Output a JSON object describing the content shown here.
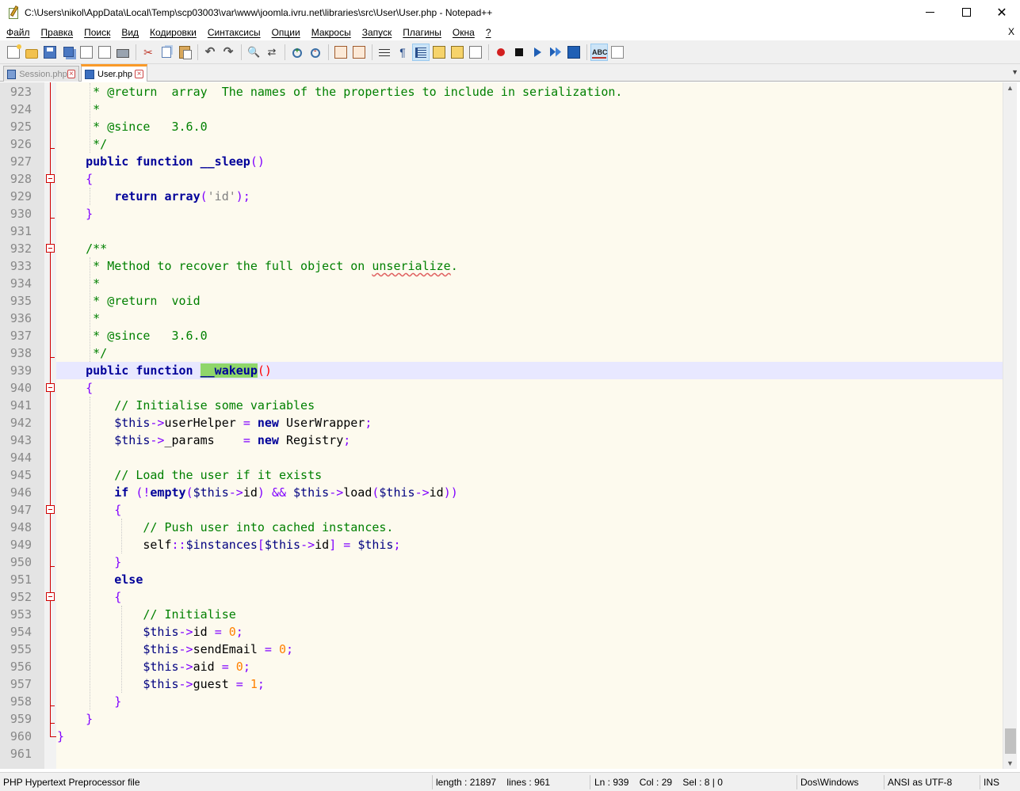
{
  "window": {
    "title": "C:\\Users\\nikol\\AppData\\Local\\Temp\\scp03003\\var\\www\\joomla.ivru.net\\libraries\\src\\User\\User.php - Notepad++",
    "min_glyph": "",
    "max_glyph": "",
    "close_glyph": "✕"
  },
  "menu": {
    "items": [
      "Файл",
      "Правка",
      "Поиск",
      "Вид",
      "Кодировки",
      "Синтаксисы",
      "Опции",
      "Макросы",
      "Запуск",
      "Плагины",
      "Окна",
      "?"
    ],
    "close_doc": "X"
  },
  "toolbar": {
    "icons": [
      "new-file-icon",
      "open-file-icon",
      "save-icon",
      "save-all-icon",
      "close-icon",
      "close-all-icon",
      "print-icon",
      "cut-icon",
      "copy-icon",
      "paste-icon",
      "undo-icon",
      "redo-icon",
      "find-icon",
      "replace-icon",
      "zoom-in-icon",
      "zoom-out-icon",
      "sync-vertical-icon",
      "sync-horizontal-icon",
      "word-wrap-icon",
      "show-all-chars-icon",
      "indent-guide-icon",
      "user-language-icon",
      "doc-map-icon",
      "function-list-icon",
      "record-macro-icon",
      "stop-macro-icon",
      "play-macro-icon",
      "run-macro-multiple-icon",
      "save-macro-icon",
      "spell-check-icon",
      "spell-options-icon"
    ]
  },
  "tabs": [
    {
      "label": "Session.php",
      "active": false
    },
    {
      "label": "User.php",
      "active": true
    }
  ],
  "editor": {
    "current_line": 939,
    "lines": [
      {
        "n": "923",
        "html": "     <span class=\"cm\">* @return  array  The names of the properties to include in serialization.</span>"
      },
      {
        "n": "924",
        "html": "     <span class=\"cm\">*</span>"
      },
      {
        "n": "925",
        "html": "     <span class=\"cm\">* @since   3.6.0</span>"
      },
      {
        "n": "926",
        "html": "     <span class=\"cm\">*/</span>"
      },
      {
        "n": "927",
        "html": "    <span class=\"k\">public</span> <span class=\"k\">function</span> <span class=\"fn\">__sleep</span><span class=\"br\">()</span>"
      },
      {
        "n": "928",
        "html": "    <span class=\"br\">{</span>"
      },
      {
        "n": "929",
        "html": "        <span class=\"k\">return</span> <span class=\"k\">array</span><span class=\"br\">(</span><span class=\"st\">'id'</span><span class=\"br\">);</span>"
      },
      {
        "n": "930",
        "html": "    <span class=\"br\">}</span>"
      },
      {
        "n": "931",
        "html": ""
      },
      {
        "n": "932",
        "html": "    <span class=\"cm\">/**</span>"
      },
      {
        "n": "933",
        "html": "     <span class=\"cm\">* Method to recover the full object on <span class=\"squig\">unserialize</span>.</span>"
      },
      {
        "n": "934",
        "html": "     <span class=\"cm\">*</span>"
      },
      {
        "n": "935",
        "html": "     <span class=\"cm\">* @return  void</span>"
      },
      {
        "n": "936",
        "html": "     <span class=\"cm\">*</span>"
      },
      {
        "n": "937",
        "html": "     <span class=\"cm\">* @since   3.6.0</span>"
      },
      {
        "n": "938",
        "html": "     <span class=\"cm\">*/</span>"
      },
      {
        "n": "939",
        "html": "    <span class=\"k\">public</span> <span class=\"k\">function</span> <span class=\"fn hl\">__wakeup</span><span class=\"hlb\">()</span>"
      },
      {
        "n": "940",
        "html": "    <span class=\"br\">{</span>"
      },
      {
        "n": "941",
        "html": "        <span class=\"cm\">// Initialise some variables</span>"
      },
      {
        "n": "942",
        "html": "        <span class=\"var\">$this</span><span class=\"op\">-&gt;</span>userHelper <span class=\"op\">=</span> <span class=\"k\">new</span> UserWrapper<span class=\"op\">;</span>"
      },
      {
        "n": "943",
        "html": "        <span class=\"var\">$this</span><span class=\"op\">-&gt;</span>_params    <span class=\"op\">=</span> <span class=\"k\">new</span> Registry<span class=\"op\">;</span>"
      },
      {
        "n": "944",
        "html": ""
      },
      {
        "n": "945",
        "html": "        <span class=\"cm\">// Load the user if it exists</span>"
      },
      {
        "n": "946",
        "html": "        <span class=\"k\">if</span> <span class=\"br\">(!</span><span class=\"k\">empty</span><span class=\"br\">(</span><span class=\"var\">$this</span><span class=\"op\">-&gt;</span>id<span class=\"br\">)</span> <span class=\"op\">&amp;&amp;</span> <span class=\"var\">$this</span><span class=\"op\">-&gt;</span>load<span class=\"br\">(</span><span class=\"var\">$this</span><span class=\"op\">-&gt;</span>id<span class=\"br\">))</span>"
      },
      {
        "n": "947",
        "html": "        <span class=\"br\">{</span>"
      },
      {
        "n": "948",
        "html": "            <span class=\"cm\">// Push user into cached instances.</span>"
      },
      {
        "n": "949",
        "html": "            self<span class=\"op\">::</span><span class=\"var\">$instances</span><span class=\"br\">[</span><span class=\"var\">$this</span><span class=\"op\">-&gt;</span>id<span class=\"br\">]</span> <span class=\"op\">=</span> <span class=\"var\">$this</span><span class=\"op\">;</span>"
      },
      {
        "n": "950",
        "html": "        <span class=\"br\">}</span>"
      },
      {
        "n": "951",
        "html": "        <span class=\"k\">else</span>"
      },
      {
        "n": "952",
        "html": "        <span class=\"br\">{</span>"
      },
      {
        "n": "953",
        "html": "            <span class=\"cm\">// Initialise</span>"
      },
      {
        "n": "954",
        "html": "            <span class=\"var\">$this</span><span class=\"op\">-&gt;</span>id <span class=\"op\">=</span> <span class=\"num\">0</span><span class=\"op\">;</span>"
      },
      {
        "n": "955",
        "html": "            <span class=\"var\">$this</span><span class=\"op\">-&gt;</span>sendEmail <span class=\"op\">=</span> <span class=\"num\">0</span><span class=\"op\">;</span>"
      },
      {
        "n": "956",
        "html": "            <span class=\"var\">$this</span><span class=\"op\">-&gt;</span>aid <span class=\"op\">=</span> <span class=\"num\">0</span><span class=\"op\">;</span>"
      },
      {
        "n": "957",
        "html": "            <span class=\"var\">$this</span><span class=\"op\">-&gt;</span>guest <span class=\"op\">=</span> <span class=\"num\">1</span><span class=\"op\">;</span>"
      },
      {
        "n": "958",
        "html": "        <span class=\"br\">}</span>"
      },
      {
        "n": "959",
        "html": "    <span class=\"br\">}</span>"
      },
      {
        "n": "960",
        "html": "<span class=\"br\">}</span>"
      },
      {
        "n": "961",
        "html": ""
      }
    ]
  },
  "status": {
    "file_type": "PHP Hypertext Preprocessor file",
    "length": "length : 21897    lines : 961",
    "position": "Ln : 939    Col : 29    Sel : 8 | 0",
    "eol": "Dos\\Windows",
    "encoding": "ANSI as UTF-8",
    "mode": "INS"
  }
}
